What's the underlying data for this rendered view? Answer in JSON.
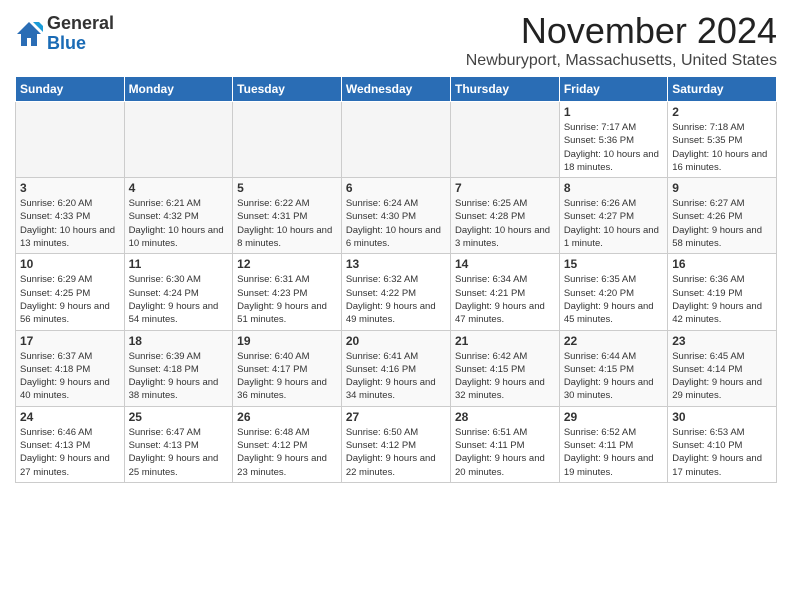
{
  "header": {
    "logo_general": "General",
    "logo_blue": "Blue",
    "month": "November 2024",
    "location": "Newburyport, Massachusetts, United States"
  },
  "weekdays": [
    "Sunday",
    "Monday",
    "Tuesday",
    "Wednesday",
    "Thursday",
    "Friday",
    "Saturday"
  ],
  "weeks": [
    [
      {
        "day": "",
        "info": ""
      },
      {
        "day": "",
        "info": ""
      },
      {
        "day": "",
        "info": ""
      },
      {
        "day": "",
        "info": ""
      },
      {
        "day": "",
        "info": ""
      },
      {
        "day": "1",
        "info": "Sunrise: 7:17 AM\nSunset: 5:36 PM\nDaylight: 10 hours and 18 minutes."
      },
      {
        "day": "2",
        "info": "Sunrise: 7:18 AM\nSunset: 5:35 PM\nDaylight: 10 hours and 16 minutes."
      }
    ],
    [
      {
        "day": "3",
        "info": "Sunrise: 6:20 AM\nSunset: 4:33 PM\nDaylight: 10 hours and 13 minutes."
      },
      {
        "day": "4",
        "info": "Sunrise: 6:21 AM\nSunset: 4:32 PM\nDaylight: 10 hours and 10 minutes."
      },
      {
        "day": "5",
        "info": "Sunrise: 6:22 AM\nSunset: 4:31 PM\nDaylight: 10 hours and 8 minutes."
      },
      {
        "day": "6",
        "info": "Sunrise: 6:24 AM\nSunset: 4:30 PM\nDaylight: 10 hours and 6 minutes."
      },
      {
        "day": "7",
        "info": "Sunrise: 6:25 AM\nSunset: 4:28 PM\nDaylight: 10 hours and 3 minutes."
      },
      {
        "day": "8",
        "info": "Sunrise: 6:26 AM\nSunset: 4:27 PM\nDaylight: 10 hours and 1 minute."
      },
      {
        "day": "9",
        "info": "Sunrise: 6:27 AM\nSunset: 4:26 PM\nDaylight: 9 hours and 58 minutes."
      }
    ],
    [
      {
        "day": "10",
        "info": "Sunrise: 6:29 AM\nSunset: 4:25 PM\nDaylight: 9 hours and 56 minutes."
      },
      {
        "day": "11",
        "info": "Sunrise: 6:30 AM\nSunset: 4:24 PM\nDaylight: 9 hours and 54 minutes."
      },
      {
        "day": "12",
        "info": "Sunrise: 6:31 AM\nSunset: 4:23 PM\nDaylight: 9 hours and 51 minutes."
      },
      {
        "day": "13",
        "info": "Sunrise: 6:32 AM\nSunset: 4:22 PM\nDaylight: 9 hours and 49 minutes."
      },
      {
        "day": "14",
        "info": "Sunrise: 6:34 AM\nSunset: 4:21 PM\nDaylight: 9 hours and 47 minutes."
      },
      {
        "day": "15",
        "info": "Sunrise: 6:35 AM\nSunset: 4:20 PM\nDaylight: 9 hours and 45 minutes."
      },
      {
        "day": "16",
        "info": "Sunrise: 6:36 AM\nSunset: 4:19 PM\nDaylight: 9 hours and 42 minutes."
      }
    ],
    [
      {
        "day": "17",
        "info": "Sunrise: 6:37 AM\nSunset: 4:18 PM\nDaylight: 9 hours and 40 minutes."
      },
      {
        "day": "18",
        "info": "Sunrise: 6:39 AM\nSunset: 4:18 PM\nDaylight: 9 hours and 38 minutes."
      },
      {
        "day": "19",
        "info": "Sunrise: 6:40 AM\nSunset: 4:17 PM\nDaylight: 9 hours and 36 minutes."
      },
      {
        "day": "20",
        "info": "Sunrise: 6:41 AM\nSunset: 4:16 PM\nDaylight: 9 hours and 34 minutes."
      },
      {
        "day": "21",
        "info": "Sunrise: 6:42 AM\nSunset: 4:15 PM\nDaylight: 9 hours and 32 minutes."
      },
      {
        "day": "22",
        "info": "Sunrise: 6:44 AM\nSunset: 4:15 PM\nDaylight: 9 hours and 30 minutes."
      },
      {
        "day": "23",
        "info": "Sunrise: 6:45 AM\nSunset: 4:14 PM\nDaylight: 9 hours and 29 minutes."
      }
    ],
    [
      {
        "day": "24",
        "info": "Sunrise: 6:46 AM\nSunset: 4:13 PM\nDaylight: 9 hours and 27 minutes."
      },
      {
        "day": "25",
        "info": "Sunrise: 6:47 AM\nSunset: 4:13 PM\nDaylight: 9 hours and 25 minutes."
      },
      {
        "day": "26",
        "info": "Sunrise: 6:48 AM\nSunset: 4:12 PM\nDaylight: 9 hours and 23 minutes."
      },
      {
        "day": "27",
        "info": "Sunrise: 6:50 AM\nSunset: 4:12 PM\nDaylight: 9 hours and 22 minutes."
      },
      {
        "day": "28",
        "info": "Sunrise: 6:51 AM\nSunset: 4:11 PM\nDaylight: 9 hours and 20 minutes."
      },
      {
        "day": "29",
        "info": "Sunrise: 6:52 AM\nSunset: 4:11 PM\nDaylight: 9 hours and 19 minutes."
      },
      {
        "day": "30",
        "info": "Sunrise: 6:53 AM\nSunset: 4:10 PM\nDaylight: 9 hours and 17 minutes."
      }
    ]
  ]
}
